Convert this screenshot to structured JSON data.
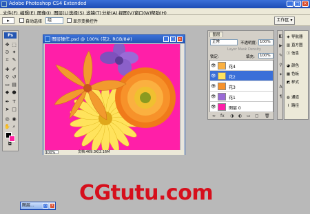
{
  "app": {
    "title": "Adobe Photoshop CS4 Extended",
    "window_controls": [
      "_",
      "□",
      "×"
    ]
  },
  "menubar": {
    "items": [
      "文件(F)",
      "编辑(E)",
      "图像(I)",
      "图层(L)",
      "选择(S)",
      "滤镜(T)",
      "分析(A)",
      "视图(V)",
      "窗口(W)",
      "帮助(H)"
    ]
  },
  "optionsbar": {
    "tool_preset": "▸",
    "auto_select_label": "自动选择",
    "auto_select_value": "组",
    "show_transform_label": "显示变换控件",
    "workspace_label": "工作区 ▾"
  },
  "toolbox": {
    "badge": "Ps",
    "colors": {
      "foreground": "#000000",
      "background": "#ff20a0"
    }
  },
  "document": {
    "title": "图层操作.psd @ 100% (花2, RGB/8#)",
    "status": "文档:469.3K/2.16M",
    "zoom": "100%",
    "canvas_color": "#ff1fa8"
  },
  "layers_panel": {
    "tab": "图层",
    "blend_mode": "正常",
    "opacity_label": "不透明度:",
    "opacity": "100%",
    "density_label": "Layer Mask Density",
    "lock_label": "锁定:",
    "fill_label": "填充:",
    "fill": "100%",
    "layers": [
      {
        "name": "花4",
        "selected": false,
        "visible": true
      },
      {
        "name": "花2",
        "selected": true,
        "visible": true
      },
      {
        "name": "花3",
        "selected": false,
        "visible": true
      },
      {
        "name": "花1",
        "selected": false,
        "visible": true
      },
      {
        "name": "图层 0",
        "selected": false,
        "visible": true
      }
    ]
  },
  "right_panel": {
    "items": [
      {
        "icon": "nav-icon",
        "label": "导航器"
      },
      {
        "icon": "histogram-icon",
        "label": "直方图"
      },
      {
        "icon": "info-icon",
        "label": "信息"
      },
      {
        "icon": "color-icon",
        "label": "颜色"
      },
      {
        "icon": "swatches-icon",
        "label": "色板"
      },
      {
        "icon": "styles-icon",
        "label": "样式"
      },
      {
        "icon": "channels-icon",
        "label": "通道"
      },
      {
        "icon": "paths-icon",
        "label": "路径"
      }
    ]
  },
  "taskbar": {
    "label": "图层..."
  },
  "watermark": "CGtutu.com"
}
